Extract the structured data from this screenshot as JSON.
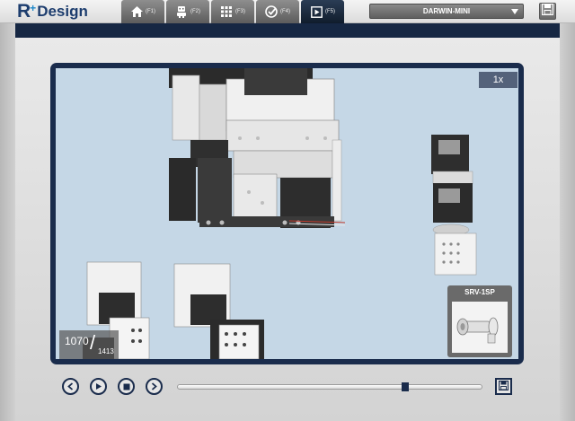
{
  "app": {
    "logo_r": "R",
    "logo_plus": "+",
    "logo_design": "Design"
  },
  "tabs": [
    {
      "key": "(F1)",
      "icon": "home-icon",
      "active": false
    },
    {
      "key": "(F2)",
      "icon": "robot-icon",
      "active": false
    },
    {
      "key": "(F3)",
      "icon": "grid-icon",
      "active": false
    },
    {
      "key": "(F4)",
      "icon": "check-icon",
      "active": false
    },
    {
      "key": "(F5)",
      "icon": "play-icon",
      "active": true
    }
  ],
  "model_select": {
    "value": "DARWIN-MINI",
    "icon": "chevron-down-icon"
  },
  "toolbar": {
    "save_icon": "floppy-disk-icon"
  },
  "viewer": {
    "zoom": "1x",
    "step_current": "1070",
    "step_separator": "/",
    "step_total": "1413",
    "part_name": "SRV-1SP"
  },
  "playback": {
    "prev_icon": "chevron-left-icon",
    "play_icon": "play-icon",
    "stop_icon": "stop-icon",
    "next_icon": "chevron-right-icon",
    "progress": 0.7552,
    "export_icon": "floppy-disk-icon"
  },
  "colors": {
    "navy": "#1a2c4c",
    "viewport_bg": "#c5d7e6",
    "tab_active": "#152238",
    "tab_inactive": "#7a7a7a"
  }
}
